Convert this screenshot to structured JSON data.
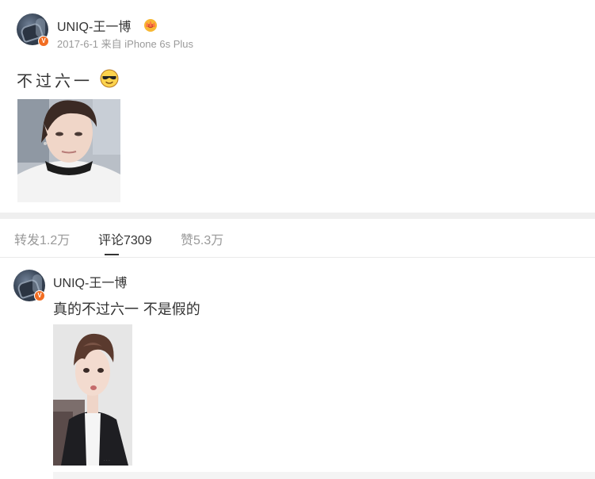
{
  "post": {
    "author": "UNIQ-王一博",
    "verified_badge": "V",
    "crown_icon": "crown-icon",
    "timestamp": "2017-6-1",
    "source": "来自 iPhone 6s Plus",
    "text": "不过六一",
    "emoji": "sunglasses-emoji",
    "image": "selfie-photo"
  },
  "tabs": [
    {
      "label": "转发1.2万",
      "active": false
    },
    {
      "label": "评论7309",
      "active": true
    },
    {
      "label": "赞5.3万",
      "active": false
    }
  ],
  "comment": {
    "author": "UNIQ-王一博",
    "verified_badge": "V",
    "text": "真的不过六一 不是假的",
    "image": "portrait-photo"
  },
  "colors": {
    "verified": "#f26d22",
    "muted_text": "#9a9a9a",
    "divider": "#efefef"
  }
}
